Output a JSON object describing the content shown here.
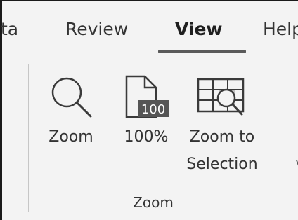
{
  "tabs": [
    {
      "label": "ta",
      "active": false
    },
    {
      "label": "Review",
      "active": false
    },
    {
      "label": "View",
      "active": true
    },
    {
      "label": "Help",
      "active": false
    }
  ],
  "group": {
    "label": "Zoom",
    "commands": [
      {
        "label": "Zoom",
        "icon": "magnifier-icon"
      },
      {
        "label": "100%",
        "icon": "page-100-icon",
        "badge": "100"
      },
      {
        "label_line1": "Zoom to",
        "label_line2": "Selection",
        "icon": "zoom-to-selection-icon"
      }
    ]
  },
  "next_group_partial_char": "V",
  "colors": {
    "background": "#f3f3f3",
    "active_tab_underline": "#5a5a5a",
    "separator": "#c6c6c6",
    "badge_fill": "#555555"
  }
}
